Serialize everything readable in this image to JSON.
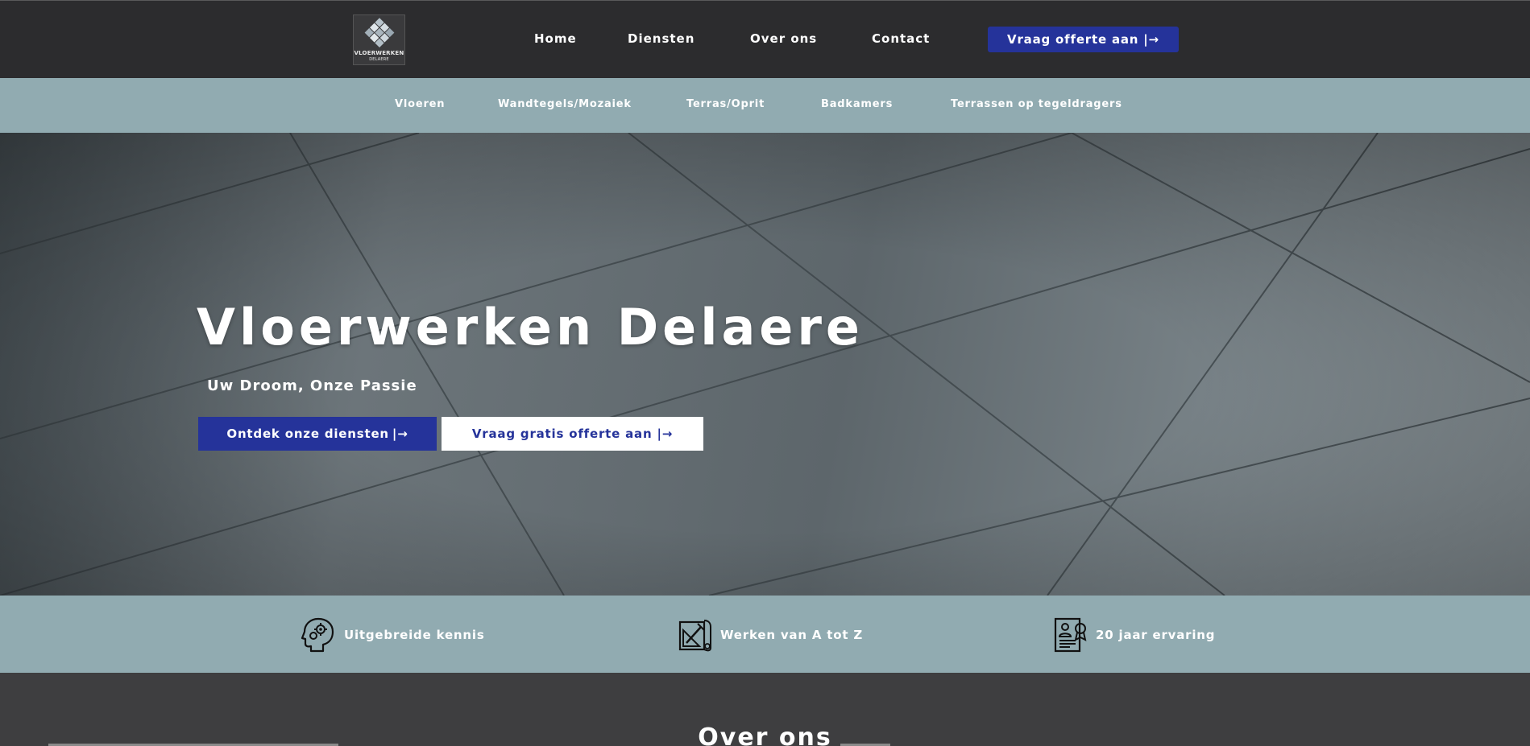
{
  "header": {
    "logo": {
      "line1": "VLOERWERKEN",
      "line2": "DELAERE"
    },
    "nav": [
      {
        "label": "Home"
      },
      {
        "label": "Diensten"
      },
      {
        "label": "Over ons"
      },
      {
        "label": "Contact"
      }
    ],
    "cta_label": "Vraag offerte aan",
    "cta_arrow": "|→"
  },
  "subnav": [
    {
      "label": "Vloeren"
    },
    {
      "label": "Wandtegels/Mozaiek"
    },
    {
      "label": "Terras/Oprit"
    },
    {
      "label": "Badkamers"
    },
    {
      "label": "Terrassen op tegeldragers"
    }
  ],
  "hero": {
    "title": "Vloerwerken Delaere",
    "subtitle": "Uw Droom, Onze Passie",
    "primary_label": "Ontdek onze diensten",
    "primary_arrow": "|→",
    "secondary_label": "Vraag gratis offerte aan",
    "secondary_arrow": "|→"
  },
  "features": [
    {
      "label": "Uitgebreide kennis",
      "icon": "head-gears-icon"
    },
    {
      "label": "Werken van A tot Z",
      "icon": "blueprint-tools-icon"
    },
    {
      "label": "20 jaar ervaring",
      "icon": "certificate-icon"
    }
  ],
  "about": {
    "title": "Over ons"
  },
  "colors": {
    "header_bg": "#2c2c2e",
    "accent_blue": "#25339a",
    "band_bg": "#91abb1",
    "section_bg": "#3e3e40"
  }
}
